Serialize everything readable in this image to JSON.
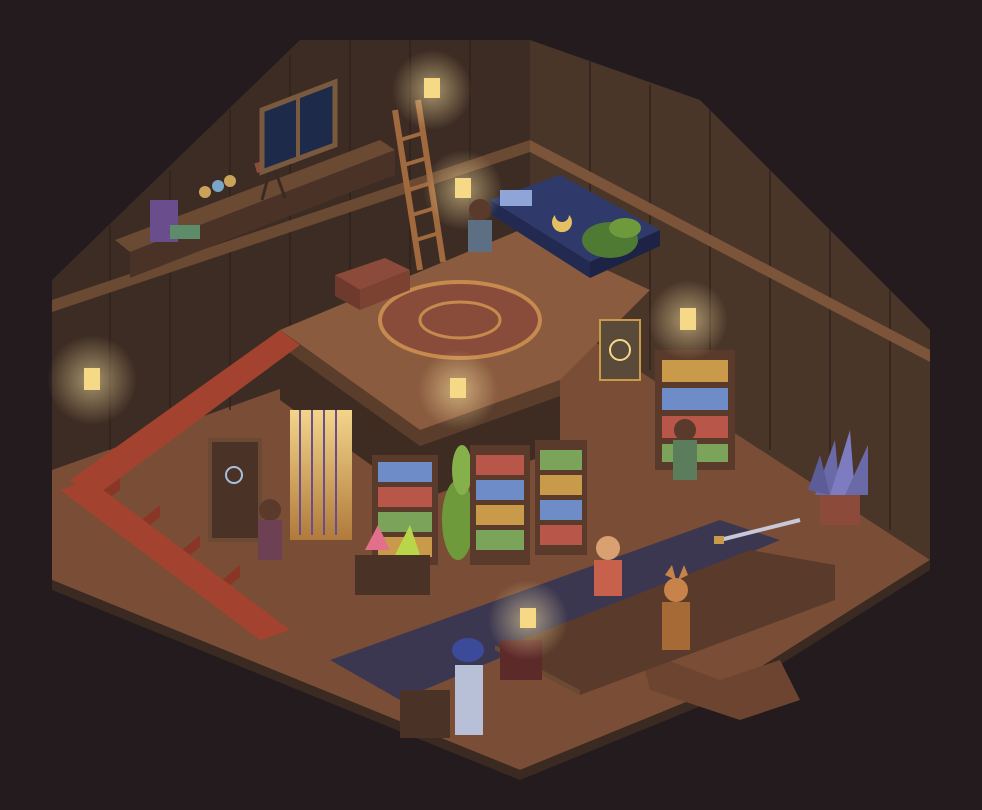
{
  "scene": {
    "palette": {
      "void": "#241b1f",
      "wall_dark": "#3a2a22",
      "wall_mid": "#4d382b",
      "wall_light": "#5e4433",
      "beam": "#6b4a33",
      "floor": "#7a4e36",
      "floor_light": "#8f5d40",
      "carpet_red": "#a3432f",
      "carpet_blue": "#3c3750",
      "rug": "#8a4c3a",
      "glow": "#f6d987",
      "gold": "#d9a84e",
      "leaf": "#6f9a3c",
      "purple": "#6a4d8c",
      "crystal_pink": "#e2708a",
      "crystal_green": "#b9d64a",
      "bed_blue": "#2f3a6b"
    },
    "icons": [
      "lamp-icon",
      "bookshelf-icon",
      "ladder-icon",
      "telescope-icon",
      "plant-icon",
      "chest-icon",
      "crystal-icon",
      "sword-icon",
      "potted-plant-icon",
      "dreamcatcher-icon",
      "moon-poster-icon"
    ],
    "characters": [
      {
        "id": "loft-reader",
        "shirt": "#5d6f82"
      },
      {
        "id": "door-visitor",
        "shirt": "#6d4054"
      },
      {
        "id": "shelf-browser",
        "shirt": "#5b7d5c"
      },
      {
        "id": "shopkeeper",
        "shirt": "#c8614b"
      },
      {
        "id": "fox-adventurer",
        "shirt": "#a56a36"
      }
    ]
  }
}
